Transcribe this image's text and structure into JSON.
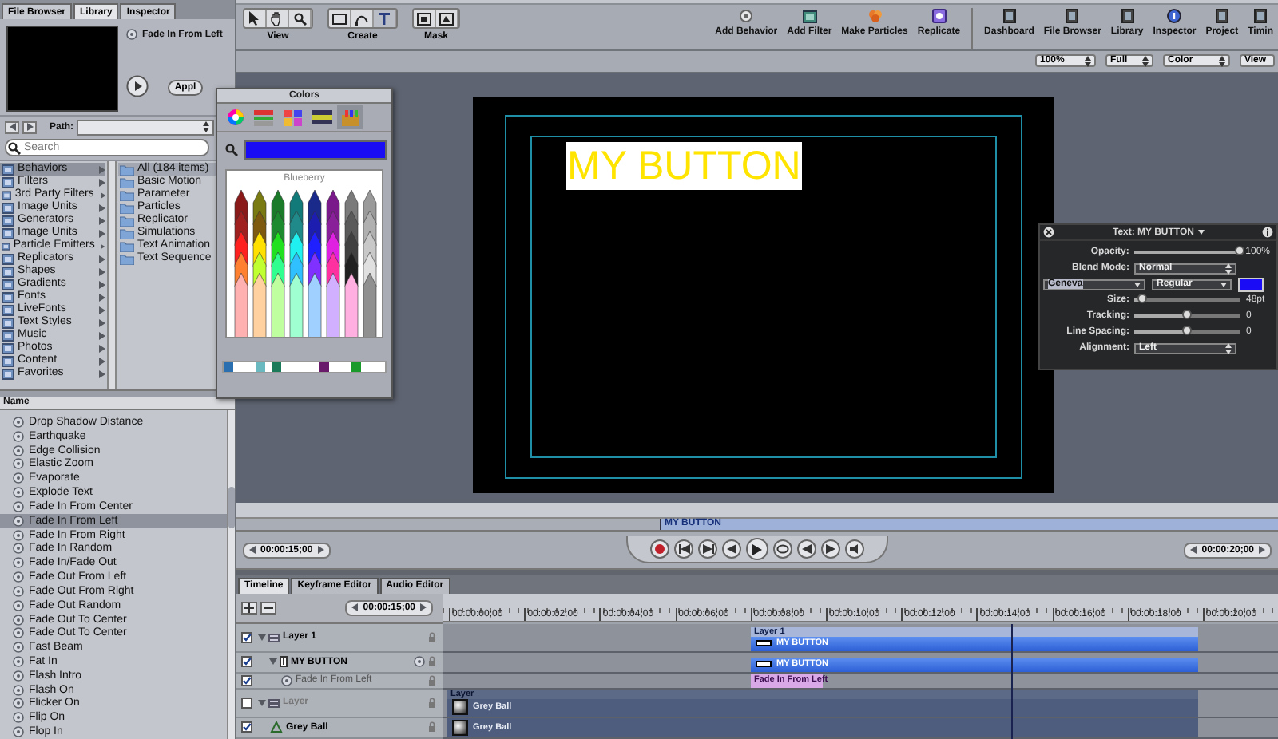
{
  "library": {
    "tabs": [
      {
        "label": "File Browser",
        "selected": false
      },
      {
        "label": "Library",
        "selected": true
      },
      {
        "label": "Inspector",
        "selected": false
      }
    ],
    "preview_title": "Fade In From Left",
    "apply_button": "Appl",
    "path_label": "Path:",
    "search": {
      "placeholder": "Search"
    },
    "categories": [
      {
        "label": "Behaviors",
        "selected": true
      },
      {
        "label": "Filters",
        "selected": false
      },
      {
        "label": "3rd Party Filters",
        "selected": false
      },
      {
        "label": "Image Units",
        "selected": false
      },
      {
        "label": "Generators",
        "selected": false
      },
      {
        "label": "Image Units",
        "selected": false
      },
      {
        "label": "Particle Emitters",
        "selected": false
      },
      {
        "label": "Replicators",
        "selected": false
      },
      {
        "label": "Shapes",
        "selected": false
      },
      {
        "label": "Gradients",
        "selected": false
      },
      {
        "label": "Fonts",
        "selected": false
      },
      {
        "label": "LiveFonts",
        "selected": false
      },
      {
        "label": "Text Styles",
        "selected": false
      },
      {
        "label": "Music",
        "selected": false
      },
      {
        "label": "Photos",
        "selected": false
      },
      {
        "label": "Content",
        "selected": false
      },
      {
        "label": "Favorites",
        "selected": false
      }
    ],
    "folders": [
      {
        "label": "All (184 items)",
        "selected": true
      },
      {
        "label": "Basic Motion",
        "selected": false
      },
      {
        "label": "Parameter",
        "selected": false
      },
      {
        "label": "Particles",
        "selected": false
      },
      {
        "label": "Replicator",
        "selected": false
      },
      {
        "label": "Simulations",
        "selected": false
      },
      {
        "label": "Text Animation",
        "selected": false
      },
      {
        "label": "Text Sequence",
        "selected": false
      }
    ],
    "list_header": "Name",
    "items": [
      {
        "label": "Drop Shadow Distance",
        "selected": false
      },
      {
        "label": "Earthquake",
        "selected": false
      },
      {
        "label": "Edge Collision",
        "selected": false
      },
      {
        "label": "Elastic Zoom",
        "selected": false
      },
      {
        "label": "Evaporate",
        "selected": false
      },
      {
        "label": "Explode Text",
        "selected": false
      },
      {
        "label": "Fade In From Center",
        "selected": false
      },
      {
        "label": "Fade In From Left",
        "selected": true
      },
      {
        "label": "Fade In From Right",
        "selected": false
      },
      {
        "label": "Fade In Random",
        "selected": false
      },
      {
        "label": "Fade In/Fade Out",
        "selected": false
      },
      {
        "label": "Fade Out From Left",
        "selected": false
      },
      {
        "label": "Fade Out From Right",
        "selected": false
      },
      {
        "label": "Fade Out Random",
        "selected": false
      },
      {
        "label": "Fade Out To Center",
        "selected": false
      },
      {
        "label": "Fade Out To Center",
        "selected": false
      },
      {
        "label": "Fast Beam",
        "selected": false
      },
      {
        "label": "Fat In",
        "selected": false
      },
      {
        "label": "Flash Intro",
        "selected": false
      },
      {
        "label": "Flash On",
        "selected": false
      },
      {
        "label": "Flicker On",
        "selected": false
      },
      {
        "label": "Flip On",
        "selected": false
      },
      {
        "label": "Flop In",
        "selected": false
      }
    ]
  },
  "toolbar": {
    "groups": [
      {
        "label": "View"
      },
      {
        "label": "Create"
      },
      {
        "label": "Mask"
      }
    ],
    "actions": [
      {
        "label": "Add Behavior"
      },
      {
        "label": "Add Filter"
      },
      {
        "label": "Make Particles"
      },
      {
        "label": "Replicate"
      }
    ],
    "windows": [
      {
        "label": "Dashboard"
      },
      {
        "label": "File Browser"
      },
      {
        "label": "Library"
      },
      {
        "label": "Inspector"
      },
      {
        "label": "Project"
      },
      {
        "label": "Timin"
      }
    ]
  },
  "view_options": [
    "100%",
    "Full",
    "Color",
    "View"
  ],
  "canvas": {
    "text": "MY BUTTON"
  },
  "mini_timeline": {
    "bar_label": "MY BUTTON"
  },
  "transport": {
    "current_time": "00:00:15;00",
    "end_time": "00:00:20;00"
  },
  "timeline": {
    "tabs": [
      {
        "label": "Timeline",
        "selected": true
      },
      {
        "label": "Keyframe Editor",
        "selected": false
      },
      {
        "label": "Audio Editor",
        "selected": false
      }
    ],
    "timecode": "00:00:15;00",
    "ruler": [
      "00:00:00;00",
      "00:00:02;00",
      "00:00:04;00",
      "00:00:06;00",
      "00:00:08;00",
      "00:00:10;00",
      "00:00:12;00",
      "00:00:14;00",
      "00:00:16;00",
      "00:00:18;00",
      "00:00:20;00"
    ],
    "layers": [
      {
        "name": "Layer 1",
        "kind": "group",
        "checked": true,
        "expanded": true,
        "children": [
          {
            "name": "MY BUTTON",
            "kind": "text",
            "checked": true,
            "expanded": true,
            "children": [
              {
                "name": "Fade In From Left",
                "kind": "behavior",
                "checked": true
              }
            ]
          }
        ]
      },
      {
        "name": "Layer",
        "kind": "group",
        "checked": false,
        "expanded": true,
        "children": [
          {
            "name": "Grey Ball",
            "kind": "shape",
            "checked": true
          }
        ]
      }
    ],
    "tracks": [
      {
        "kind": "group",
        "header": "Layer 1",
        "bar": "MY BUTTON"
      },
      {
        "kind": "object",
        "bar": "MY BUTTON"
      },
      {
        "kind": "behavior",
        "bar": "Fade In From Left"
      },
      {
        "kind": "group-thumb",
        "header": "Layer",
        "bar": "Grey Ball"
      },
      {
        "kind": "thumb",
        "bar": "Grey Ball"
      }
    ]
  },
  "colors": {
    "title": "Colors",
    "mode_tabs": [
      {
        "selected": false
      },
      {
        "selected": false
      },
      {
        "selected": false
      },
      {
        "selected": false
      },
      {
        "selected": true
      }
    ],
    "crayon_name": "Blueberry"
  },
  "hud": {
    "title": "Text: MY BUTTON",
    "rows": [
      {
        "kind": "slider",
        "label": "Opacity:",
        "level": 1,
        "reading": "100%"
      },
      {
        "kind": "dropdown",
        "label": "Blend Mode:",
        "value": "Normal"
      },
      {
        "kind": "font",
        "family": "Geneva",
        "style": "Regular",
        "color": "#1a0cf4"
      },
      {
        "kind": "slider",
        "label": "Size:",
        "level": 0.08,
        "reading": "48pt"
      },
      {
        "kind": "slider",
        "label": "Tracking:",
        "level": 0.5,
        "reading": "0"
      },
      {
        "kind": "slider",
        "label": "Line Spacing:",
        "level": 0.5,
        "reading": "0"
      },
      {
        "kind": "dropdown",
        "label": "Alignment:",
        "value": "Left"
      }
    ]
  }
}
